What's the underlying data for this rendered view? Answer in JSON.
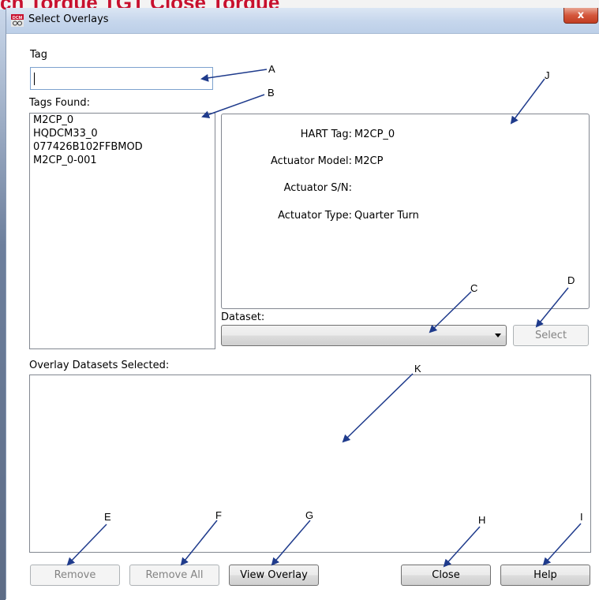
{
  "background": {
    "partial_title": "ch Torque          TGT Close Torque"
  },
  "window": {
    "title": "Select Overlays",
    "close_glyph": "x",
    "app_icon_text": "DCM"
  },
  "tag": {
    "label": "Tag",
    "value": ""
  },
  "tags_found": {
    "label": "Tags Found:",
    "items": [
      "M2CP_0",
      "HQDCM33_0",
      "077426B102FFBMOD",
      "M2CP_0-001"
    ]
  },
  "info": {
    "hart_tag_label": "HART Tag:",
    "hart_tag_value": "M2CP_0",
    "model_label": "Actuator Model:",
    "model_value": "M2CP",
    "sn_label": "Actuator S/N:",
    "sn_value": "",
    "type_label": "Actuator Type:",
    "type_value": "Quarter Turn"
  },
  "dataset": {
    "label": "Dataset:",
    "selected": ""
  },
  "buttons": {
    "select": "Select",
    "remove": "Remove",
    "remove_all": "Remove All",
    "view_overlay": "View Overlay",
    "close": "Close",
    "help": "Help"
  },
  "overlay": {
    "label": "Overlay Datasets Selected:"
  },
  "annotations": [
    "A",
    "B",
    "C",
    "D",
    "E",
    "F",
    "G",
    "H",
    "I",
    "J",
    "K"
  ],
  "colors": {
    "arrow": "#1f3b8c",
    "title_red": "#c8102e"
  }
}
